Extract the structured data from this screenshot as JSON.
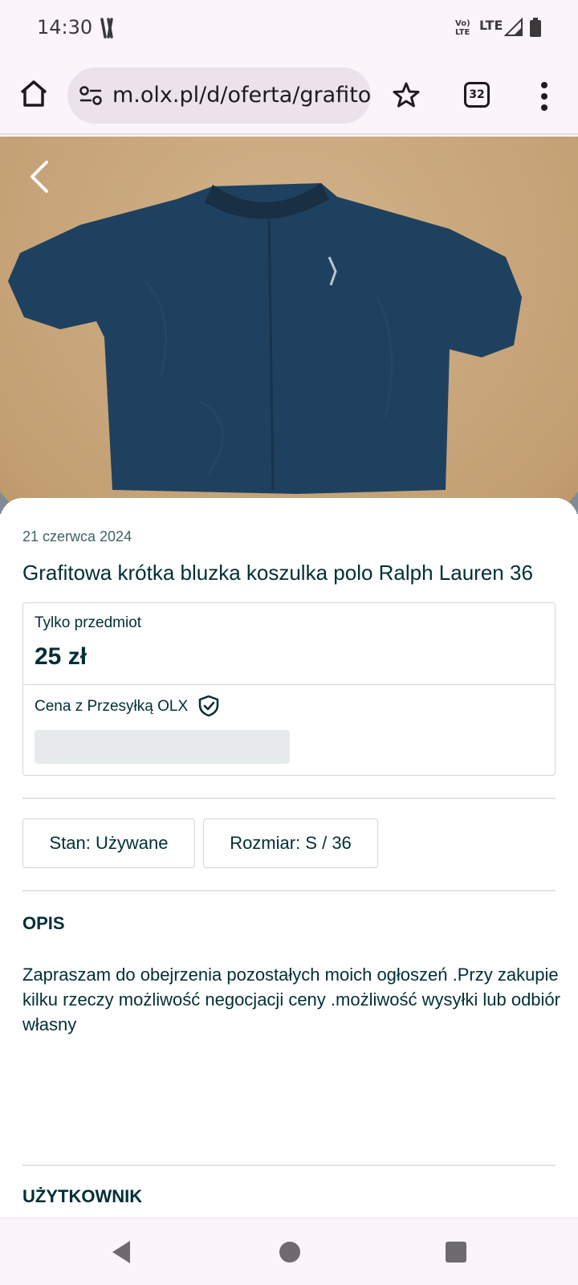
{
  "status_bar": {
    "time": "14:30",
    "volte_label_top": "Vo)",
    "volte_label_bottom": "LTE",
    "network_label": "LTE"
  },
  "browser": {
    "url": "m.olx.pl/d/oferta/grafito",
    "tab_count": "32",
    "icons": [
      "home-icon",
      "site-settings-icon",
      "star-icon",
      "tab-switcher-icon",
      "more-vert-icon"
    ]
  },
  "listing": {
    "date": "21 czerwca 2024",
    "title": "Grafitowa krótka bluzka koszulka polo Ralph Lauren 36",
    "price_label": "Tylko przedmiot",
    "price": "25 zł",
    "shipping_label": "Cena z Przesyłką OLX",
    "params": {
      "condition": "Stan: Używane",
      "size": "Rozmiar: S / 36"
    },
    "description_heading": "OPIS",
    "description": "Zapraszam do obejrzenia pozostałych moich ogłoszeń .Przy zakupie kilku rzeczy możliwość negocjacji ceny .możliwość wysyłki lub odbiór własny",
    "user_heading": "UŻYTKOWNIK"
  },
  "colors": {
    "olx_text": "#002f34",
    "browser_chrome": "#fcf4fb",
    "url_pill": "#ebe2ec",
    "shirt": "#1f4160",
    "table": "#c7a57a"
  }
}
